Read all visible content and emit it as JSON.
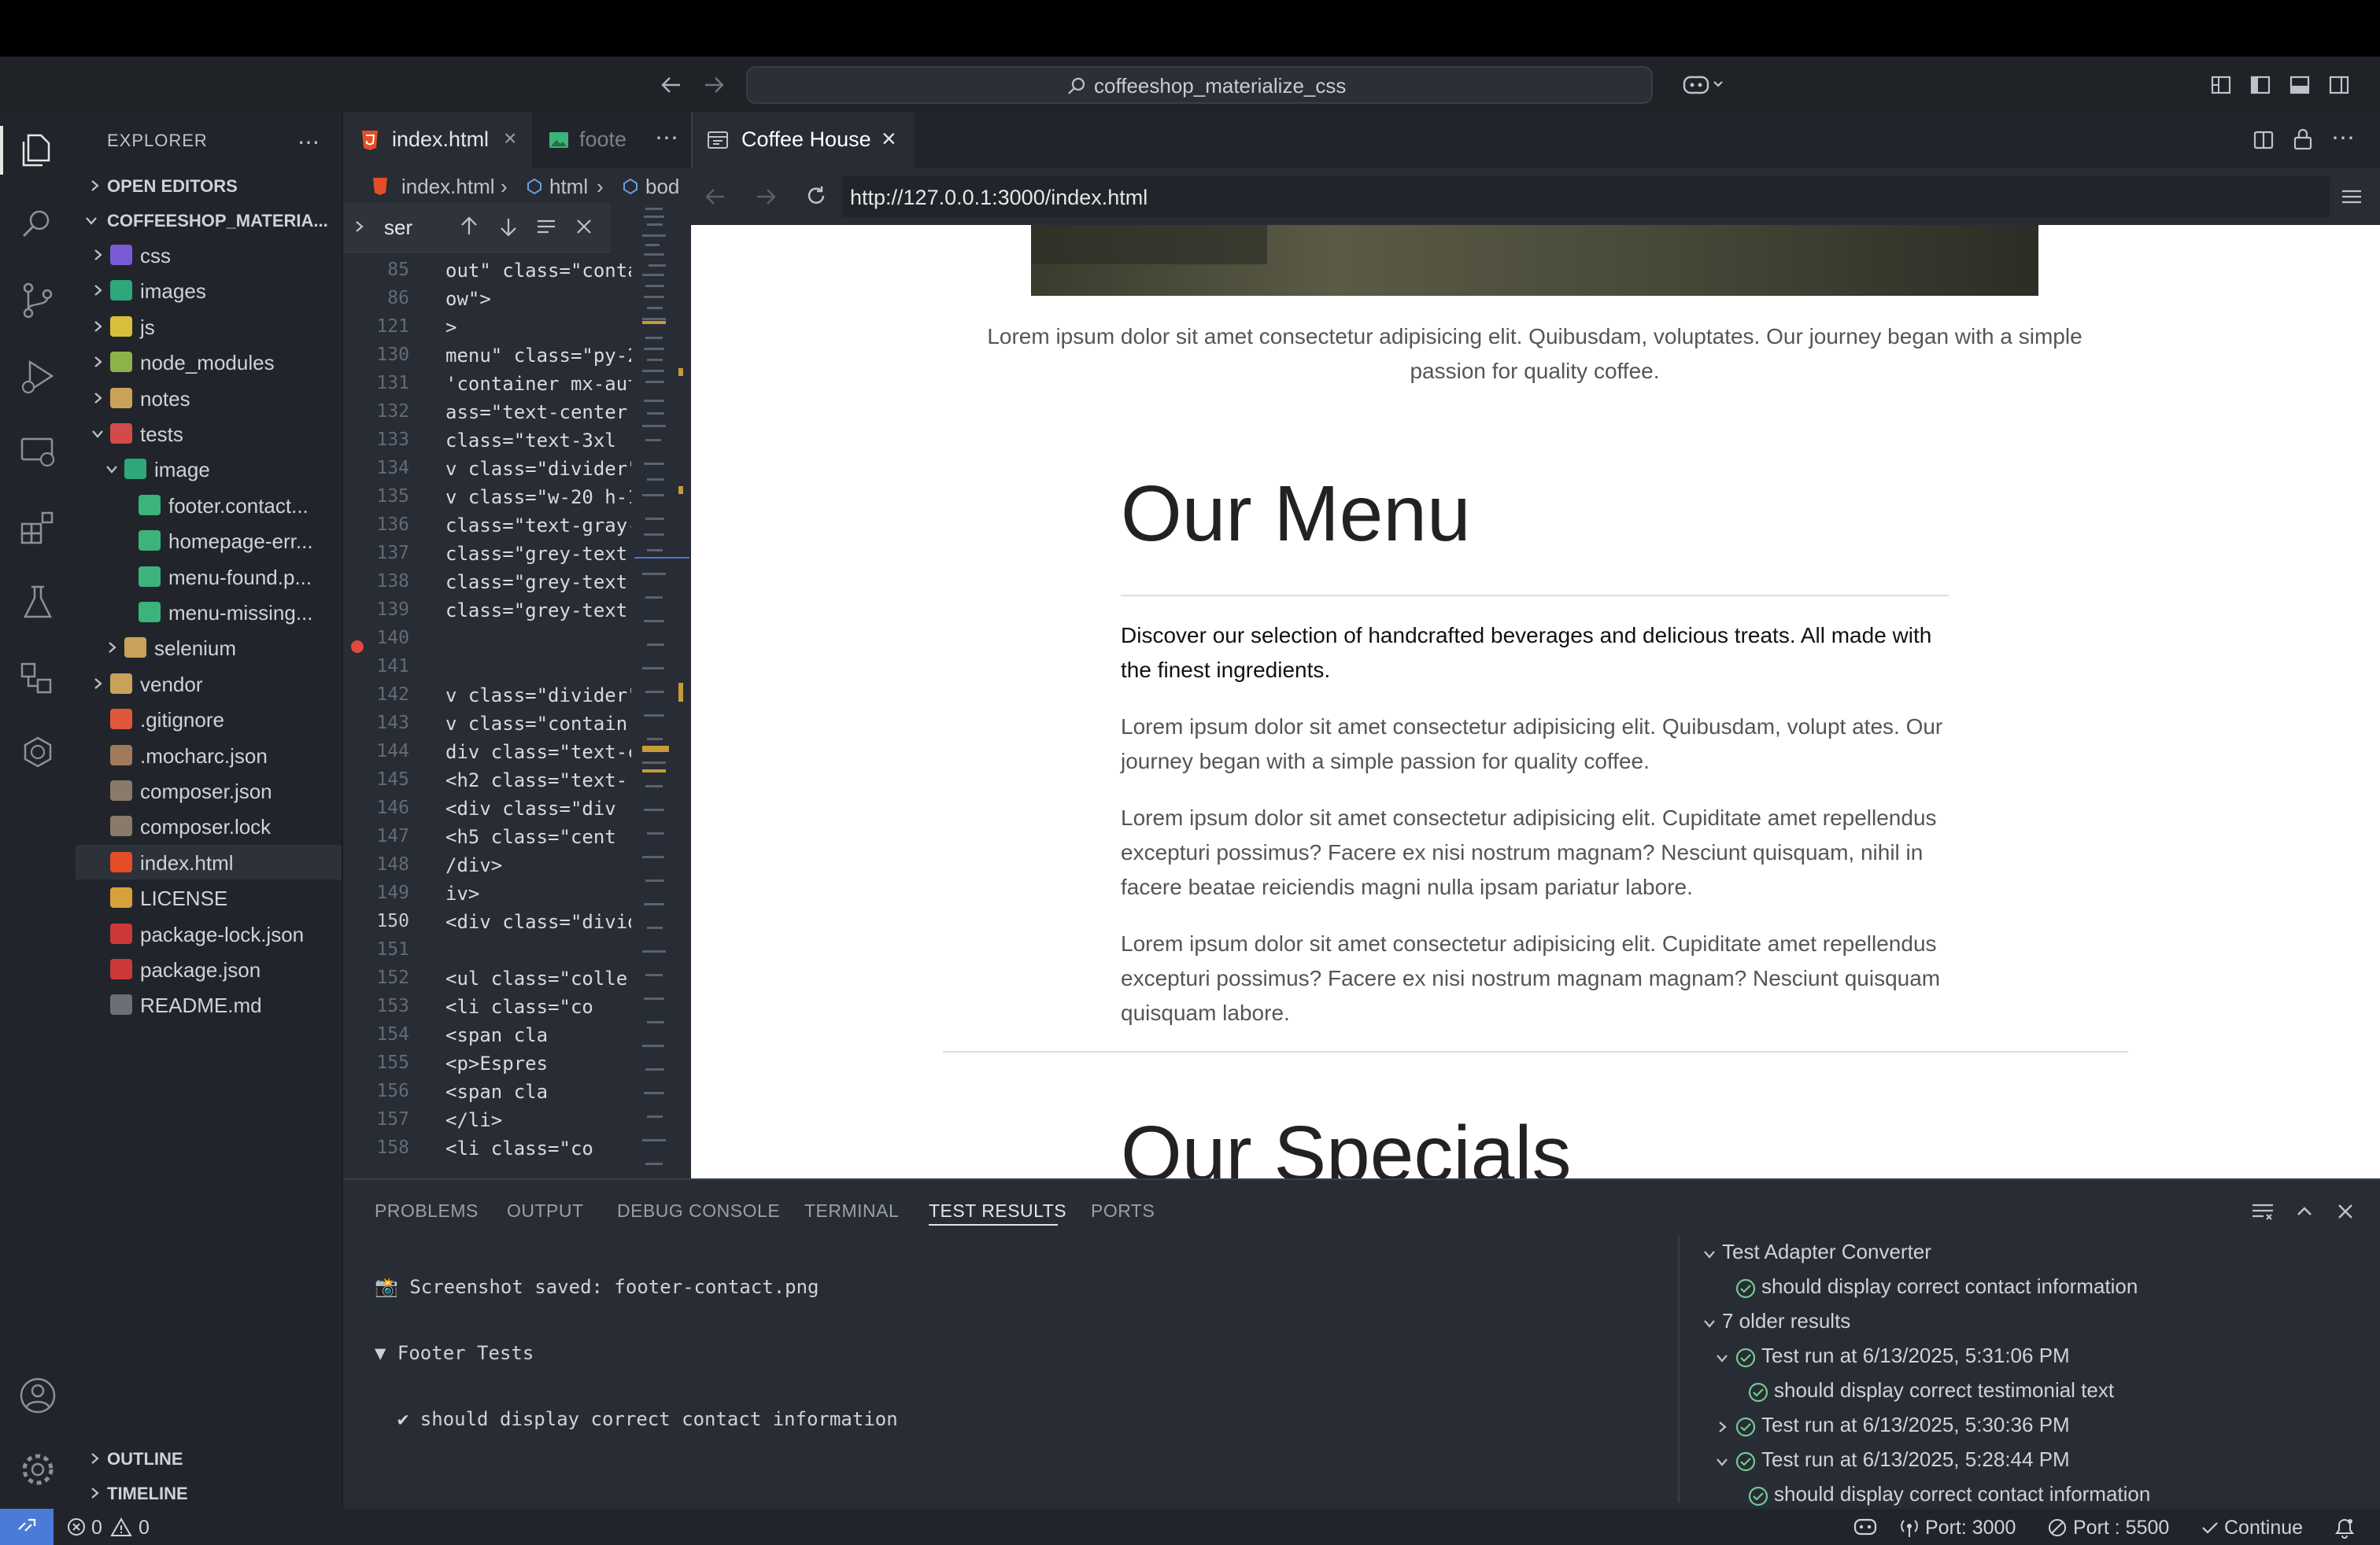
{
  "window": {
    "command_center": "coffeeshop_materialize_css"
  },
  "sidebar": {
    "title": "EXPLORER",
    "open_editors": "OPEN EDITORS",
    "project": "COFFEESHOP_MATERIA...",
    "tree": [
      {
        "label": "css",
        "icon": "folder-css-icon",
        "color": "#7b5ad6"
      },
      {
        "label": "images",
        "icon": "folder-images-icon",
        "color": "#2ea77a"
      },
      {
        "label": "js",
        "icon": "folder-js-icon",
        "color": "#d8c03a"
      },
      {
        "label": "node_modules",
        "icon": "folder-node-icon",
        "color": "#8bb34a"
      },
      {
        "label": "notes",
        "icon": "folder-icon",
        "color": "#c9a25a"
      },
      {
        "label": "tests",
        "icon": "folder-tests-icon",
        "color": "#d34a4a"
      },
      {
        "label": "image",
        "icon": "folder-images-icon",
        "color": "#2ea77a"
      },
      {
        "label": "footer.contact...",
        "icon": "image-file-icon",
        "color": "#3cb37a"
      },
      {
        "label": "homepage-err...",
        "icon": "image-file-icon",
        "color": "#3cb37a"
      },
      {
        "label": "menu-found.p...",
        "icon": "image-file-icon",
        "color": "#3cb37a"
      },
      {
        "label": "menu-missing...",
        "icon": "image-file-icon",
        "color": "#3cb37a"
      },
      {
        "label": "selenium",
        "icon": "folder-icon",
        "color": "#c9a25a"
      },
      {
        "label": "vendor",
        "icon": "folder-icon",
        "color": "#c9a25a"
      },
      {
        "label": ".gitignore",
        "icon": "git-icon",
        "color": "#e0573a"
      },
      {
        "label": ".mocharc.json",
        "icon": "mocha-icon",
        "color": "#a07a5a"
      },
      {
        "label": "composer.json",
        "icon": "composer-icon",
        "color": "#8a7a6a"
      },
      {
        "label": "composer.lock",
        "icon": "composer-icon",
        "color": "#8a7a6a"
      },
      {
        "label": "index.html",
        "icon": "html-icon",
        "color": "#e44d26"
      },
      {
        "label": "LICENSE",
        "icon": "license-icon",
        "color": "#d8a03a"
      },
      {
        "label": "package-lock.json",
        "icon": "npm-icon",
        "color": "#cb3837"
      },
      {
        "label": "package.json",
        "icon": "npm-icon",
        "color": "#cb3837"
      },
      {
        "label": "README.md",
        "icon": "markdown-icon",
        "color": "#6a6f78"
      }
    ],
    "outline": "OUTLINE",
    "timeline": "TIMELINE"
  },
  "editor": {
    "tabs": [
      {
        "label": "index.html"
      },
      {
        "label": "foote"
      }
    ],
    "breadcrumbs": [
      "index.html",
      "html",
      "bod"
    ],
    "find": {
      "value": "ser"
    },
    "lines": [
      {
        "n": "85",
        "code": "out\" class=\"conta"
      },
      {
        "n": "86",
        "code": "ow\">"
      },
      {
        "n": "121",
        "code": ">"
      },
      {
        "n": "130",
        "code": "menu\" class=\"py-2"
      },
      {
        "n": "131",
        "code": "'container mx-aut"
      },
      {
        "n": "132",
        "code": "ass=\"text-center"
      },
      {
        "n": "133",
        "code": " class=\"text-3xl"
      },
      {
        "n": "134",
        "code": "v class=\"divider\""
      },
      {
        "n": "135",
        "code": "v class=\"w-20 h-1"
      },
      {
        "n": "136",
        "code": "class=\"text-gray-"
      },
      {
        "n": "137",
        "code": "class=\"grey-text"
      },
      {
        "n": "138",
        "code": "class=\"grey-text"
      },
      {
        "n": "139",
        "code": "class=\"grey-text"
      },
      {
        "n": "140",
        "code": ""
      },
      {
        "n": "141",
        "code": ""
      },
      {
        "n": "142",
        "code": "v class=\"divider\""
      },
      {
        "n": "143",
        "code": "v class=\"contain"
      },
      {
        "n": "144",
        "code": "div class=\"text-c"
      },
      {
        "n": "145",
        "code": " <h2 class=\"text-"
      },
      {
        "n": "146",
        "code": " <div class=\"div"
      },
      {
        "n": "147",
        "code": " <h5 class=\"cent"
      },
      {
        "n": "148",
        "code": "/div>"
      },
      {
        "n": "149",
        "code": "iv>"
      },
      {
        "n": "150",
        "code": "<div class=\"divid"
      },
      {
        "n": "151",
        "code": ""
      },
      {
        "n": "152",
        "code": "<ul class=\"colle"
      },
      {
        "n": "153",
        "code": "    <li class=\"co"
      },
      {
        "n": "154",
        "code": "        <span cla"
      },
      {
        "n": "155",
        "code": "        <p>Espres"
      },
      {
        "n": "156",
        "code": "        <span cla"
      },
      {
        "n": "157",
        "code": "    </li>"
      },
      {
        "n": "158",
        "code": "    <li class=\"co"
      }
    ]
  },
  "browser": {
    "tab_title": "Coffee House",
    "url": "http://127.0.0.1:3000/index.html",
    "page": {
      "intro": "Lorem ipsum dolor sit amet consectetur adipisicing elit. Quibusdam, voluptates. Our journey began with a simple passion for quality coffee.",
      "menu_heading": "Our Menu",
      "menu_lead": "Discover our selection of handcrafted beverages and delicious treats. All made with the finest ingredients.",
      "paragraphs": [
        "Lorem ipsum dolor sit amet consectetur adipisicing elit. Quibusdam, volupt ates. Our journey began with a simple passion for quality coffee.",
        "Lorem ipsum dolor sit amet consectetur adipisicing elit. Cupiditate amet repellendus excepturi possimus? Facere ex nisi nostrum magnam? Nesciunt quisquam, nihil in facere beatae reiciendis magni nulla ipsam pariatur labore.",
        "Lorem ipsum dolor sit amet consectetur adipisicing elit. Cupiditate amet repellendus excepturi possimus? Facere ex nisi nostrum magnam magnam? Nesciunt quisquam quisquam labore."
      ],
      "specials_heading": "Our Specials"
    }
  },
  "panel": {
    "tabs": [
      "PROBLEMS",
      "OUTPUT",
      "DEBUG CONSOLE",
      "TERMINAL",
      "TEST RESULTS",
      "PORTS"
    ],
    "active_tab": "TEST RESULTS",
    "output": [
      "📸 Screenshot saved: footer-contact.png",
      "▼ Footer Tests",
      "  ✔ should display correct contact information"
    ],
    "results": {
      "adapter": "Test Adapter Converter",
      "adapter_result": "should display correct contact information",
      "older": "7 older results",
      "runs": [
        {
          "label": "Test run at 6/13/2025, 5:31:06 PM",
          "child": "should display correct testimonial text"
        },
        {
          "label": "Test run at 6/13/2025, 5:30:36 PM",
          "child": ""
        },
        {
          "label": "Test run at 6/13/2025, 5:28:44 PM",
          "child": "should display correct contact information"
        }
      ]
    }
  },
  "status": {
    "errors": "0",
    "warnings": "0",
    "port1": "Port: 3000",
    "port2": "Port : 5500",
    "continue": "Continue"
  }
}
